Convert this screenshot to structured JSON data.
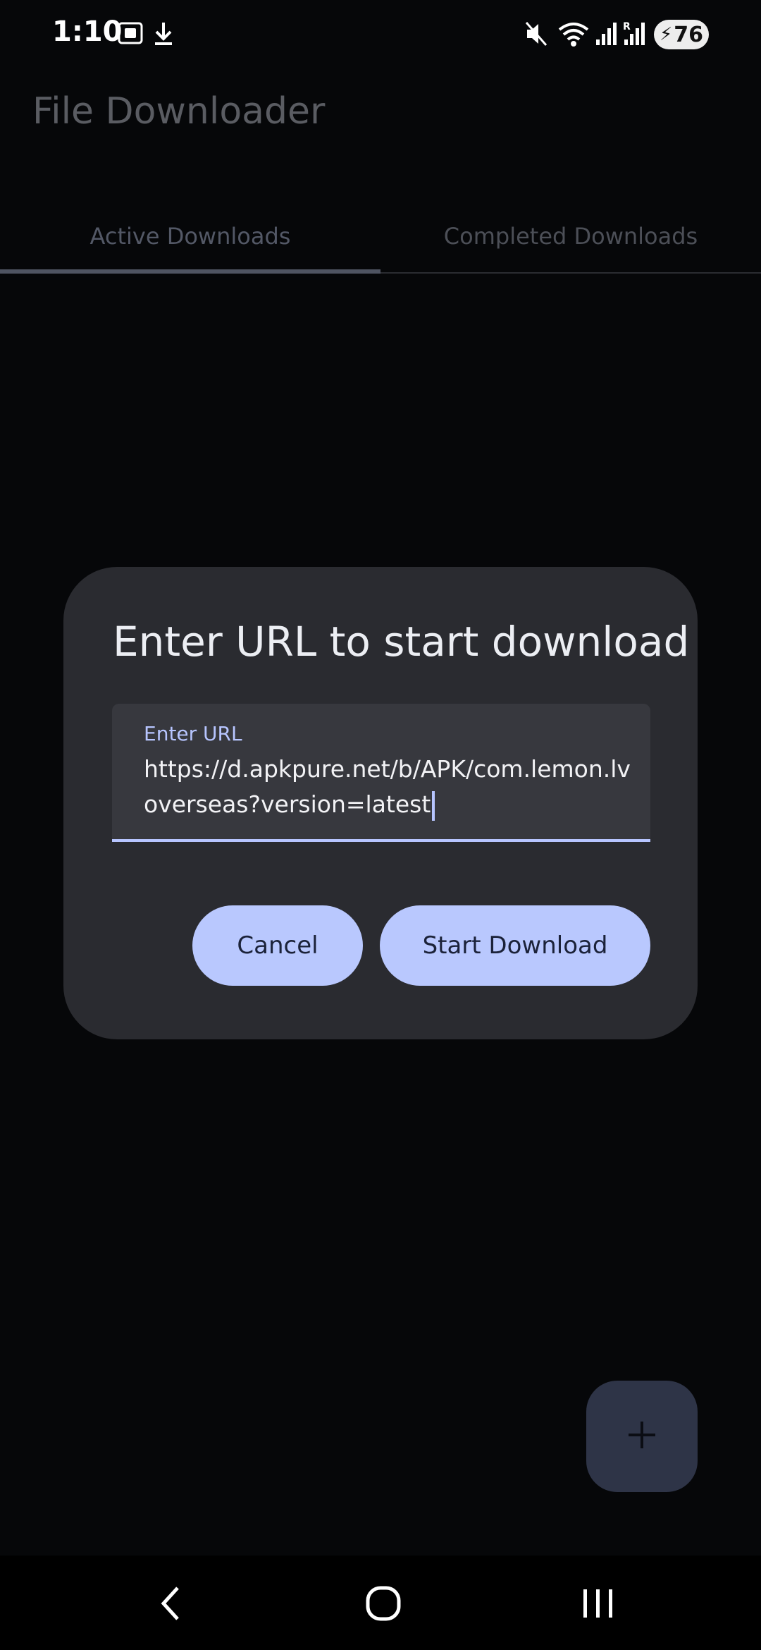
{
  "status_bar": {
    "time": "1:10",
    "battery": "76",
    "icons": [
      "screenshot-icon",
      "download-icon",
      "mute-icon",
      "wifi-icon",
      "signal-icon",
      "roaming-signal-icon",
      "battery-charging-icon"
    ]
  },
  "app_bar": {
    "title": "File Downloader"
  },
  "tabs": [
    {
      "label": "Active Downloads",
      "selected": true
    },
    {
      "label": "Completed Downloads",
      "selected": false
    }
  ],
  "dialog": {
    "title": "Enter URL to start download",
    "url_field": {
      "label": "Enter URL",
      "value": "https://d.apkpure.net/b/APK/com.lemon.lvoverseas?version=latest"
    },
    "cancel_label": "Cancel",
    "start_label": "Start Download"
  },
  "fab": {
    "icon": "plus-icon"
  },
  "nav_bar": {
    "icons": [
      "back-icon",
      "home-icon",
      "recents-icon"
    ]
  },
  "colors": {
    "background": "#060709",
    "dialog": "#2a2b30",
    "accent": "#b9c8fe",
    "fab": "#2e3447"
  }
}
